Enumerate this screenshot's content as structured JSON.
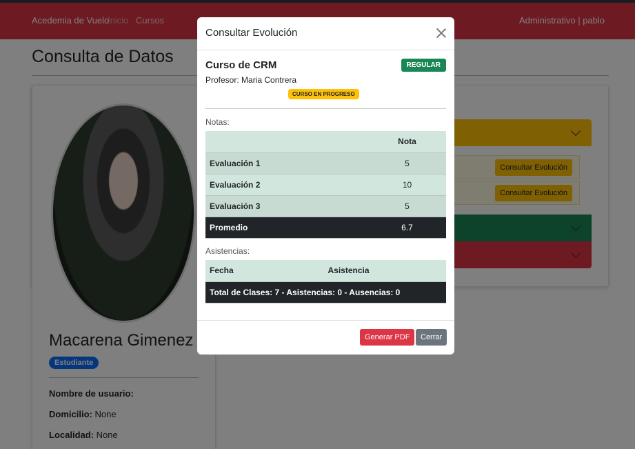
{
  "navbar": {
    "brand": "Acedemia de Vuelo",
    "links": [
      "Inicio",
      "Cursos"
    ],
    "user": "Administrativo | pablo"
  },
  "page": {
    "title": "Consulta de Datos"
  },
  "profile": {
    "name": "Macarena Gimenez",
    "role": "Estudiante",
    "fields": [
      {
        "label": "Nombre de usuario:",
        "value": ""
      },
      {
        "label": "Domicilio:",
        "value": "None"
      },
      {
        "label": "Localidad:",
        "value": "None"
      }
    ]
  },
  "courses": {
    "evolution_buttons": [
      "Consultar Evolución",
      "Consultar Evolución"
    ]
  },
  "modal": {
    "title": "Consultar Evolución",
    "course_name": "Curso de CRM",
    "status_badge": "REGULAR",
    "teacher": "Profesor: Maria Contrera",
    "progress_badge": "CURSO EN PROGRESO",
    "grades_label": "Notas:",
    "grades_header": {
      "name": "",
      "value": "Nota"
    },
    "grades": [
      {
        "name": "Evaluación 1",
        "value": "5"
      },
      {
        "name": "Evaluación 2",
        "value": "10"
      },
      {
        "name": "Evaluación 3",
        "value": "5"
      }
    ],
    "average": {
      "name": "Promedio",
      "value": "6.7"
    },
    "attendance_label": "Asistencias:",
    "attendance_header": {
      "date": "Fecha",
      "attendance": "Asistencia"
    },
    "attendance_summary": "Total de Clases: 7 - Asistencias: 0 - Ausencias: 0",
    "buttons": {
      "pdf": "Generar PDF",
      "close": "Cerrar"
    }
  },
  "colors": {
    "navbar": "#dc3545",
    "success": "#198754",
    "warning": "#ffc107",
    "primary": "#0d6efd",
    "secondary": "#6c757d",
    "table_header": "#d1e7dd",
    "table_dark": "#212529"
  }
}
